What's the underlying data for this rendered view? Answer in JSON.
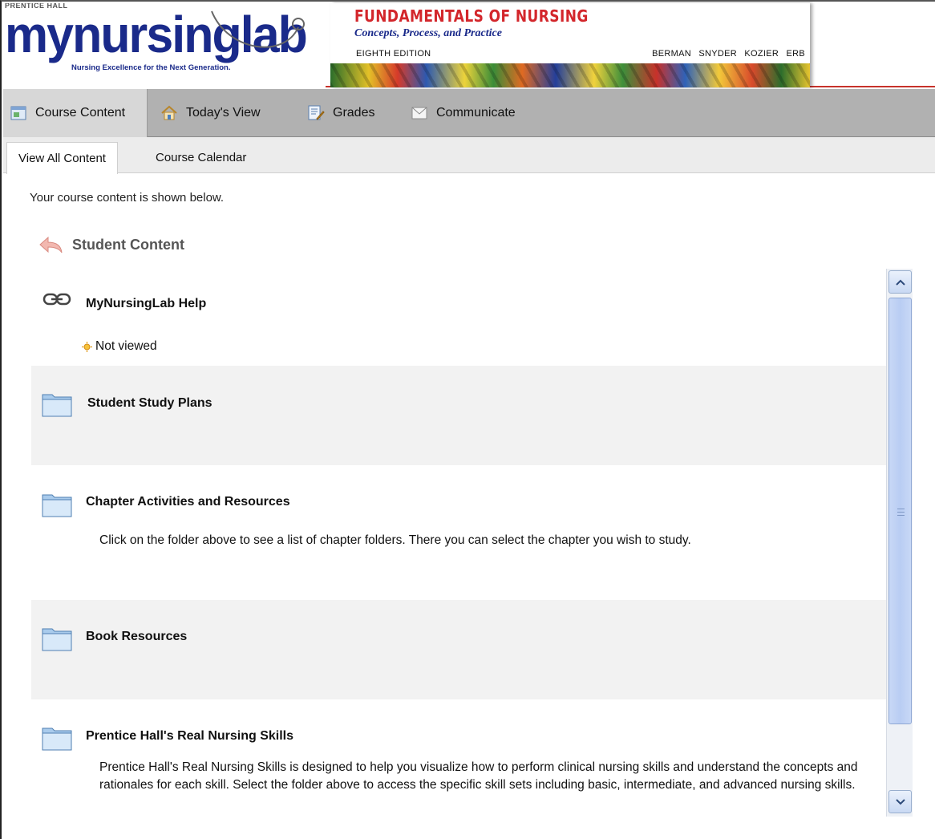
{
  "header": {
    "publisher": "PRENTICE HALL",
    "logo": "mynursinglab",
    "logo_tagline": "Nursing Excellence for the Next Generation.",
    "book_title": "FUNDAMENTALS OF NURSING",
    "book_subtitle": "Concepts, Process, and Practice",
    "edition": "EIGHTH EDITION",
    "authors": "BERMAN SNYDER KOZIER ERB"
  },
  "nav": {
    "items": [
      {
        "label": "Course Content",
        "icon": "course-content-icon"
      },
      {
        "label": "Today's View",
        "icon": "home-icon"
      },
      {
        "label": "Grades",
        "icon": "grades-icon"
      },
      {
        "label": "Communicate",
        "icon": "envelope-icon"
      }
    ]
  },
  "tabs": {
    "items": [
      {
        "label": "View All Content"
      },
      {
        "label": "Course Calendar"
      }
    ]
  },
  "main": {
    "intro": "Your course content is shown below.",
    "section_title": "Student Content",
    "items": [
      {
        "title": "MyNursingLab Help",
        "type": "link",
        "status": "Not viewed"
      },
      {
        "title": "Student Study Plans",
        "type": "folder"
      },
      {
        "title": "Chapter Activities and Resources",
        "type": "folder",
        "description": "Click on the folder above to see a list of chapter folders. There you can select the chapter you wish to study."
      },
      {
        "title": "Book Resources",
        "type": "folder"
      },
      {
        "title": "Prentice Hall's Real Nursing Skills",
        "type": "folder",
        "description": "Prentice Hall's Real Nursing Skills is designed to help you visualize how to perform clinical nursing skills and understand the concepts and rationales for each skill. Select the folder above to access the specific skill sets including basic, intermediate, and advanced nursing skills."
      }
    ]
  },
  "colors": {
    "logo_blue": "#1a2a8a",
    "title_red": "#d3262b",
    "navbar_gray": "#b1b1b1",
    "status_orange": "#f0a020"
  }
}
